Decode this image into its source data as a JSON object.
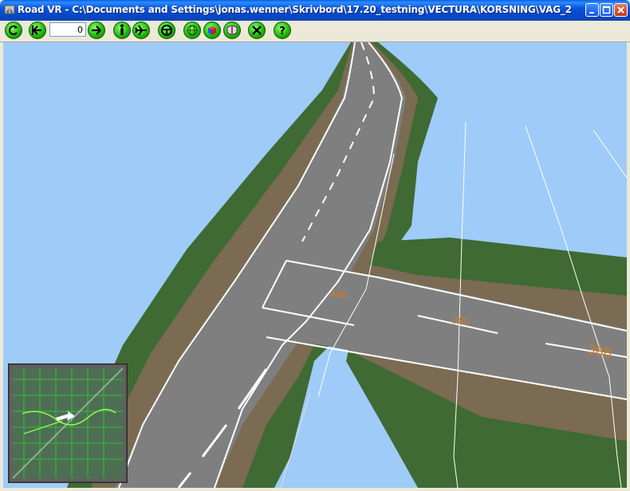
{
  "window": {
    "title": "Road VR - C:\\Documents and Settings\\jonas.wenner\\Skrivbord\\17.20_testning\\VECTURA\\KORSNING\\VAG_2"
  },
  "toolbar": {
    "frame_value": "0",
    "buttons": [
      "reset-view",
      "step-back",
      "step-forward",
      "walk-mode",
      "fly-mode",
      "drive-mode",
      "globe",
      "color-cube",
      "layers",
      "tools",
      "help"
    ]
  },
  "scene": {
    "road_labels": [
      "400",
      "380",
      "380"
    ]
  },
  "colors": {
    "sky": "#9FCBF8",
    "asphalt": "#7F7F7F",
    "shoulder": "#7A6B52",
    "grass": "#3F6A33",
    "titlebar": "#0A53D8",
    "toolbar_button": "#22B80E",
    "label": "#E07A1F"
  }
}
